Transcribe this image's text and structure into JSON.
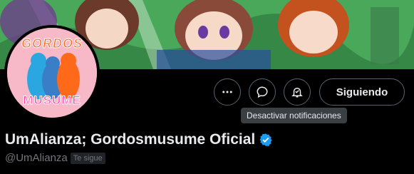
{
  "profile": {
    "display_name": "UmAlianza; Gordosmusume Oficial",
    "handle": "@UmAlianza",
    "follows_you_badge": "Te sigue",
    "avatar_text_top": "GORDOS",
    "avatar_text_bottom": "MUSUME"
  },
  "actions": {
    "more_icon": "more-horizontal-icon",
    "message_icon": "message-bubble-icon",
    "notify_icon": "bell-off-icon",
    "follow_label": "Siguiendo",
    "notify_tooltip": "Desactivar notificaciones"
  },
  "colors": {
    "background": "#000000",
    "text": "#e7e9ea",
    "muted": "#71767b",
    "verified": "#1d9bf0",
    "border": "#536471"
  }
}
